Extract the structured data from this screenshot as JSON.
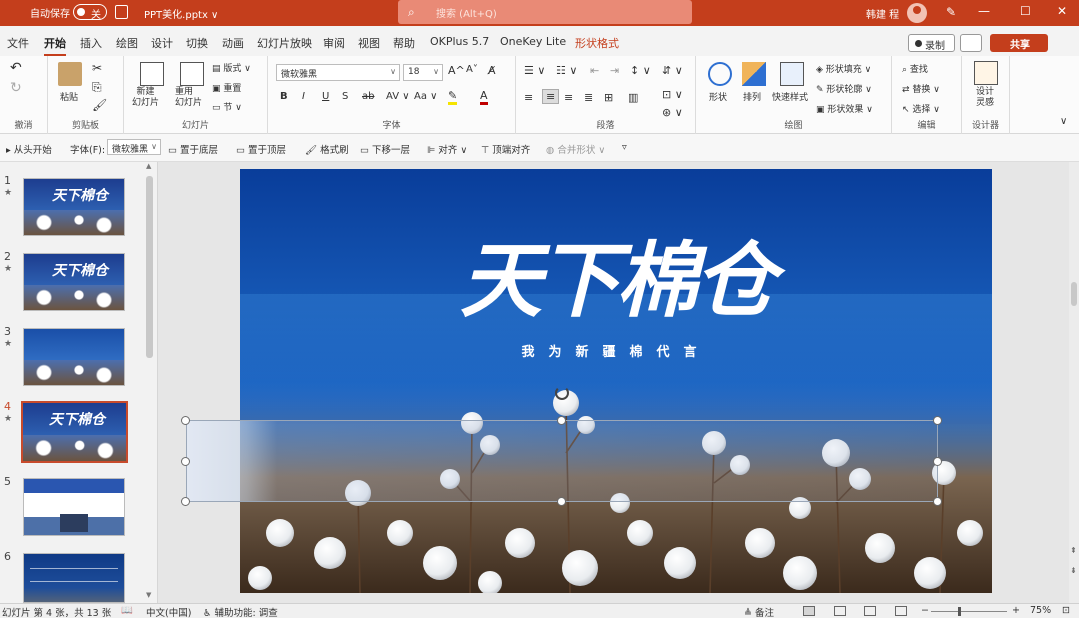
{
  "titlebar": {
    "autosave_label": "自动保存",
    "autosave_state": "关",
    "filename": "PPT美化.pptx ∨",
    "search_placeholder": "搜索 (Alt+Q)",
    "user_name": "韩建 程",
    "minimize": "—",
    "maximize": "☐",
    "close": "✕"
  },
  "menu": {
    "tabs": [
      "文件",
      "开始",
      "插入",
      "绘图",
      "设计",
      "切换",
      "动画",
      "幻灯片放映",
      "审阅",
      "视图",
      "帮助",
      "OKPlus 5.7",
      "OneKey Lite",
      "形状格式"
    ],
    "record": "录制",
    "share": "共享"
  },
  "ribbon": {
    "groups": {
      "undo": "撤消",
      "clipboard": "剪贴板",
      "slides": "幻灯片",
      "font": "字体",
      "paragraph": "段落",
      "drawing": "绘图",
      "editing": "编辑",
      "designer": "设计器"
    },
    "paste": "粘贴",
    "new_slide": "新建\n幻灯片",
    "reuse_slide": "重用\n幻灯片",
    "layout": "版式",
    "reset": "重置",
    "section": "节",
    "font_name": "微软雅黑",
    "font_size": "18",
    "bold": "B",
    "italic": "I",
    "underline": "U",
    "shadow": "S",
    "strike": "ab",
    "shape": "形状",
    "arrange": "排列",
    "quick_styles": "快速样式",
    "shape_fill": "形状填充",
    "shape_outline": "形状轮廓",
    "shape_effects": "形状效果",
    "find": "查找",
    "replace": "替换",
    "select": "选择",
    "design_ideas": "设计\n灵感"
  },
  "quickbar": {
    "from_start": "从头开始",
    "font_label": "字体(F):",
    "font_value": "微软雅黑",
    "send_back": "置于底层",
    "bring_front": "置于顶层",
    "format_painter": "格式刷",
    "move_down": "下移一层",
    "align": "对齐",
    "align_top": "顶端对齐",
    "merge_shapes": "合并形状"
  },
  "thumbnails": [
    {
      "num": "1",
      "star": "★"
    },
    {
      "num": "2",
      "star": "★"
    },
    {
      "num": "3",
      "star": "★"
    },
    {
      "num": "4",
      "star": "★"
    },
    {
      "num": "5",
      "star": ""
    },
    {
      "num": "6",
      "star": ""
    }
  ],
  "slide": {
    "title": "天下棉仓",
    "subtitle": "我为新疆棉代言"
  },
  "statusbar": {
    "slide_info": "幻灯片 第 4 张，共 13 张",
    "language": "中文(中国)",
    "accessibility": "辅助功能: 调查",
    "notes": "备注",
    "zoom": "75%"
  },
  "colors": {
    "accent": "#c43e1c",
    "slide_blue": "#1556b3"
  }
}
